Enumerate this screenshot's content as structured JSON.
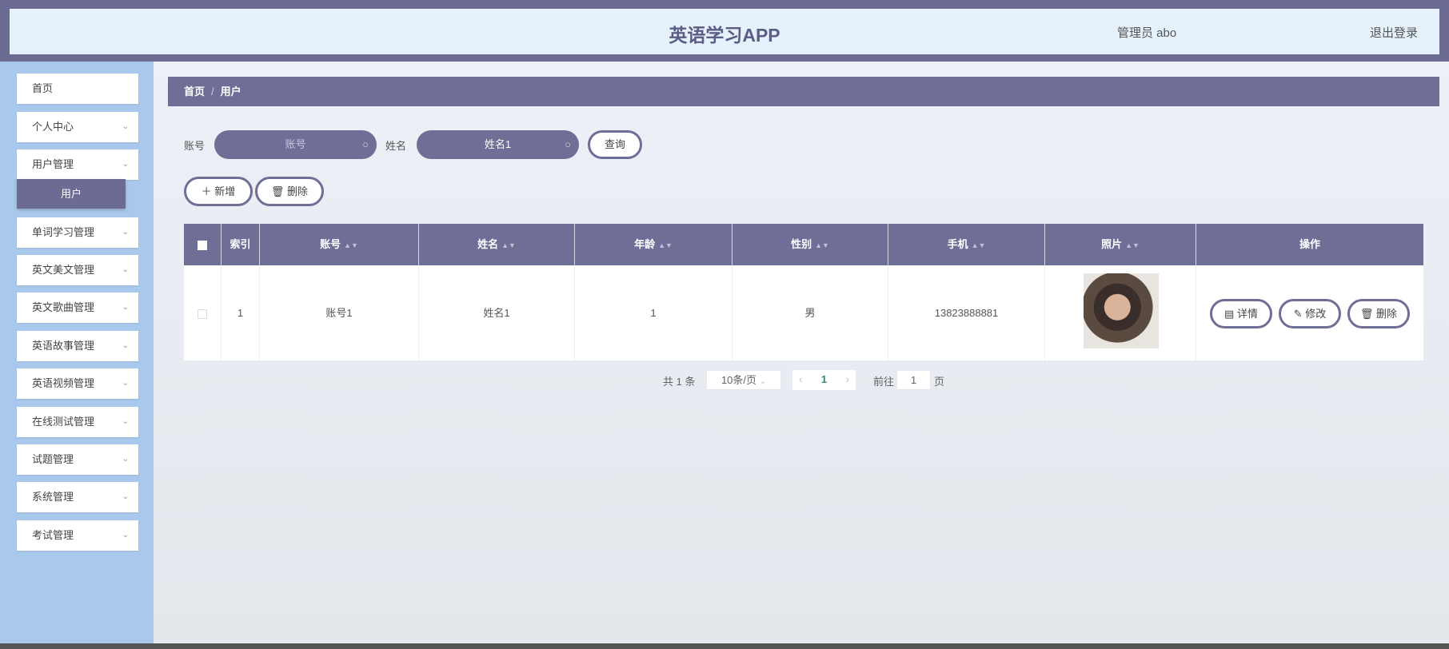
{
  "header": {
    "title": "英语学习APP",
    "user": "管理员 abo",
    "logout": "退出登录"
  },
  "sidebar": {
    "items": [
      {
        "label": "首页"
      },
      {
        "label": "个人中心"
      },
      {
        "label": "用户管理"
      },
      {
        "label": "单词学习管理"
      },
      {
        "label": "英文美文管理"
      },
      {
        "label": "英文歌曲管理"
      },
      {
        "label": "英语故事管理"
      },
      {
        "label": "英语视频管理"
      },
      {
        "label": "在线测试管理"
      },
      {
        "label": "试题管理"
      },
      {
        "label": "系统管理"
      },
      {
        "label": "考试管理"
      }
    ],
    "sub_item": "用户",
    "chevron": "⌄"
  },
  "breadcrumb": {
    "home": "首页",
    "sep": "/",
    "current": "用户"
  },
  "search": {
    "account_label": "账号",
    "account_placeholder": "账号",
    "name_label": "姓名",
    "name_value": "姓名1",
    "query": "查询"
  },
  "toolbar": {
    "add": "新增",
    "delete": "删除"
  },
  "table": {
    "columns": [
      "索引",
      "账号",
      "姓名",
      "年龄",
      "性别",
      "手机",
      "照片",
      "操作"
    ],
    "rows": [
      {
        "index": "1",
        "account": "账号1",
        "name": "姓名1",
        "age": "1",
        "gender": "男",
        "phone": "13823888881"
      }
    ],
    "actions": {
      "detail": "详情",
      "edit": "修改",
      "delete": "删除"
    }
  },
  "pagination": {
    "total": "共 1 条",
    "page_size": "10条/页",
    "current": "1",
    "goto": "前往",
    "goto_value": "1",
    "page_suffix": "页"
  },
  "colors": {
    "primary": "#6e6e96",
    "sidebar": "#a9c9ec",
    "header_bg": "#e5f2fc"
  }
}
